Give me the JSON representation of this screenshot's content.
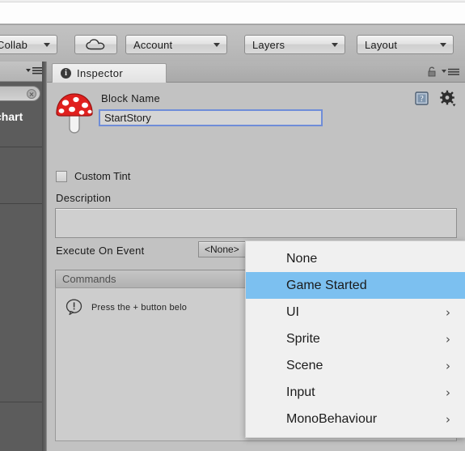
{
  "toolbar": {
    "buttons": [
      {
        "label": "Collab",
        "icon": "cloud-collab-icon",
        "has_caret": true
      },
      {
        "label": "",
        "icon": "cloud-icon",
        "has_caret": false
      },
      {
        "label": "Account",
        "icon": "",
        "has_caret": true
      },
      {
        "label": "Layers",
        "icon": "",
        "has_caret": true
      },
      {
        "label": "Layout",
        "icon": "",
        "has_caret": true
      }
    ]
  },
  "left_panel": {
    "title_fragment": "chart",
    "search_value": ""
  },
  "inspector": {
    "tab_label": "Inspector",
    "block_name_label": "Block Name",
    "block_name_value": "StartStory",
    "custom_tint_label": "Custom Tint",
    "custom_tint_checked": false,
    "description_label": "Description",
    "description_value": "",
    "execute_on_event_label": "Execute On Event",
    "execute_on_event_value": "<None>",
    "commands_header": "Commands",
    "commands_hint": "Press the + button belo"
  },
  "menu": {
    "items": [
      {
        "label": "None",
        "selected": false,
        "has_submenu": false
      },
      {
        "label": "Game Started",
        "selected": true,
        "has_submenu": false
      },
      {
        "label": "UI",
        "selected": false,
        "has_submenu": true
      },
      {
        "label": "Sprite",
        "selected": false,
        "has_submenu": true
      },
      {
        "label": "Scene",
        "selected": false,
        "has_submenu": true
      },
      {
        "label": "Input",
        "selected": false,
        "has_submenu": true
      },
      {
        "label": "MonoBehaviour",
        "selected": false,
        "has_submenu": true
      }
    ],
    "submenu_glyph": "›",
    "highlight_color": "#7cc0f0"
  },
  "colors": {
    "window_bg": "#c2c2c2",
    "toolbar_bg": "#bcbcbc",
    "dark_panel": "#5c5c5c",
    "focus_border": "#6f8dd8",
    "menu_bg": "#f0f0f0"
  }
}
